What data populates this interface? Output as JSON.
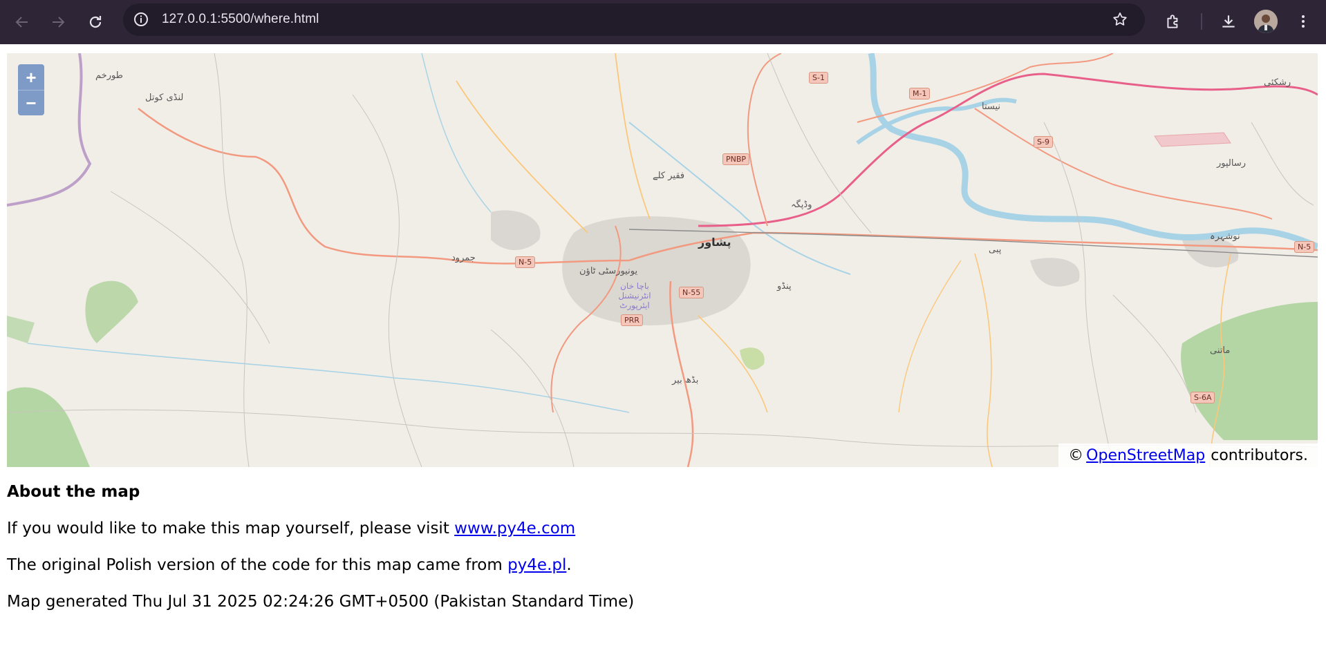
{
  "browser": {
    "url": "127.0.0.1:5500/where.html",
    "icons": {
      "back": "arrow-left-icon",
      "forward": "arrow-right-icon",
      "reload": "reload-icon",
      "info": "info-icon",
      "bookmark": "star-icon",
      "extensions": "puzzle-icon",
      "downloads": "download-icon",
      "profile": "avatar",
      "menu": "kebab-menu-icon"
    }
  },
  "map": {
    "zoom_in_label": "+",
    "zoom_out_label": "−",
    "attribution_prefix": "©",
    "attribution_link": "OpenStreetMap",
    "attribution_suffix": "contributors.",
    "city_label": "پشاور",
    "place_labels": [
      "طورخم",
      "لنڈی کوتل",
      "فقیر کلے",
      "جمرود",
      "یونیورسٹی ٹاؤن",
      "باچا خان انٹرنیشنل ایئرپورٹ",
      "پبی",
      "نوشہرہ",
      "پنڈو",
      "بڈھ بیر",
      "ماتنی",
      "رسالپور",
      "نیستا",
      "رشکئی",
      "وڈپگہ"
    ],
    "road_shields": [
      "S-1",
      "M-1",
      "PNBP",
      "S-9",
      "N-5",
      "N-55",
      "PRR",
      "S-6A",
      "N-5"
    ],
    "colors": {
      "land": "#f1eee8",
      "river": "#a8d3e6",
      "motorway": "#e8608a",
      "trunk": "#f2997f",
      "primary": "#fbc77b",
      "urban": "#d7d3ce",
      "forest": "#a5cf92"
    }
  },
  "about": {
    "heading": "About the map",
    "line1_text": "If you would like to make this map yourself, please visit ",
    "line1_link": "www.py4e.com",
    "line2_text": "The original Polish version of the code for this map came from ",
    "line2_link": "py4e.pl",
    "line2_end": ".",
    "line3_text": "Map generated Thu Jul 31 2025 02:24:26 GMT+0500 (Pakistan Standard Time)"
  }
}
